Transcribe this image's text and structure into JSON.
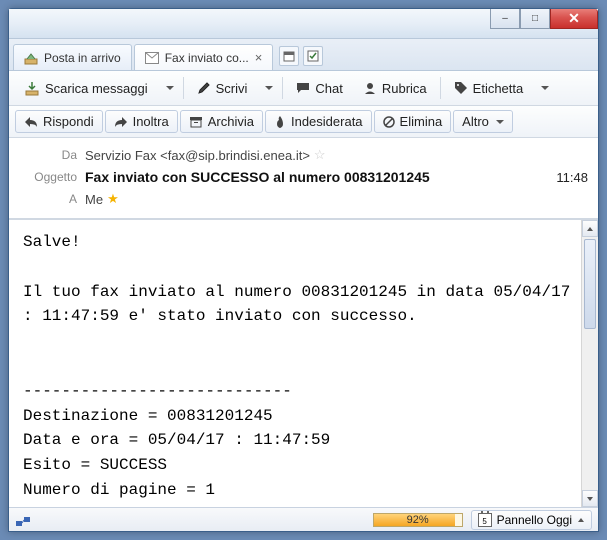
{
  "window": {
    "minimize": "–",
    "maximize": "□",
    "close": "✕"
  },
  "tabs": {
    "inbox": "Posta in arrivo",
    "active": "Fax inviato co...",
    "active_close": "×"
  },
  "toolbar": {
    "download": "Scarica messaggi",
    "compose": "Scrivi",
    "chat": "Chat",
    "addressbook": "Rubrica",
    "tag": "Etichetta"
  },
  "msgtoolbar": {
    "reply": "Rispondi",
    "forward": "Inoltra",
    "archive": "Archivia",
    "junk": "Indesiderata",
    "delete": "Elimina",
    "other": "Altro"
  },
  "headers": {
    "from_label": "Da",
    "from_value": "Servizio Fax <fax@sip.brindisi.enea.it>",
    "subject_label": "Oggetto",
    "subject_value": "Fax inviato con SUCCESSO al numero 00831201245",
    "to_label": "A",
    "to_value": "Me",
    "time": "11:48"
  },
  "body_text": "Salve!\n\nIl tuo fax inviato al numero 00831201245 in data 05/04/17 : 11:47:59 e' stato inviato con successo.\n\n\n----------------------------\nDestinazione = 00831201245\nData e ora = 05/04/17 : 11:47:59\nEsito = SUCCESS\nNumero di pagine = 1\n----------------------------",
  "status": {
    "progress_pct": "92%",
    "progress_fill": 92,
    "panel": "Pannello Oggi",
    "cal_day": "5"
  }
}
